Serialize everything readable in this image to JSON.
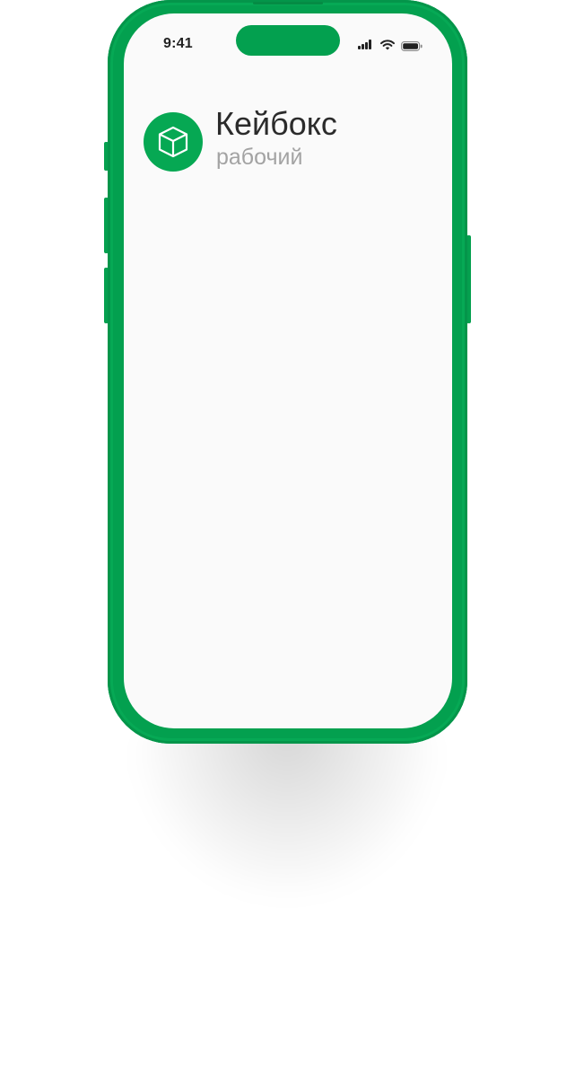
{
  "status_bar": {
    "time": "9:41",
    "icons": [
      "cellular-signal-icon",
      "wifi-icon",
      "battery-icon"
    ]
  },
  "app": {
    "title": "Кейбокс",
    "subtitle": "рабочий",
    "icon": "cube-icon"
  },
  "colors": {
    "device_frame": "#03a04f",
    "accent": "#06a853",
    "screen_background": "#fafafa",
    "title_text": "#2b2b2b",
    "subtitle_text": "#a3a3a3"
  }
}
